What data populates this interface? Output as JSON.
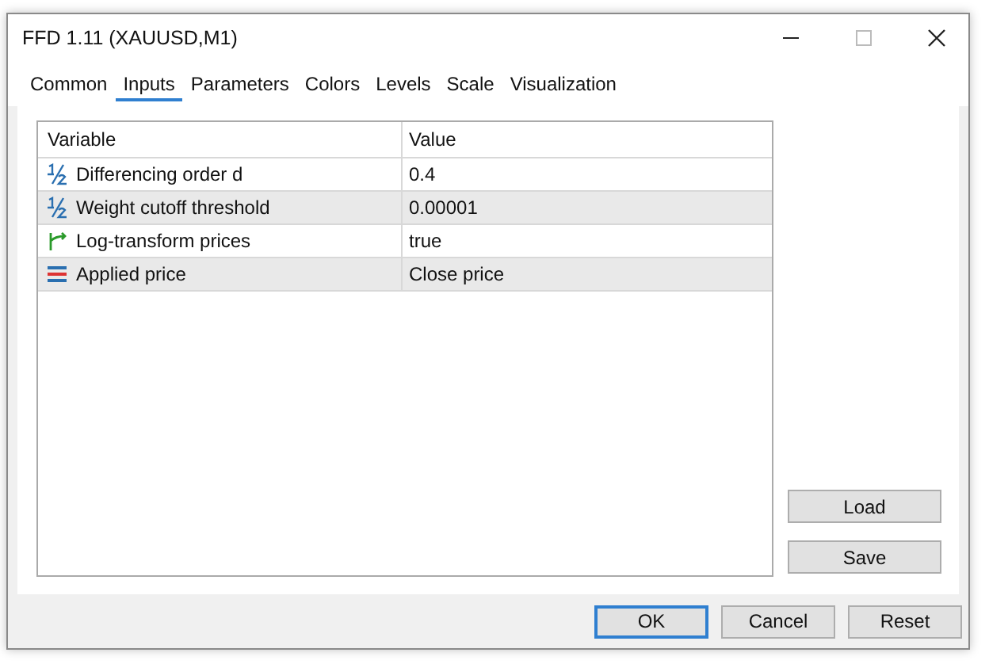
{
  "window": {
    "title": "FFD 1.11 (XAUUSD,M1)"
  },
  "tabs": [
    {
      "label": "Common",
      "selected": false
    },
    {
      "label": "Inputs",
      "selected": true
    },
    {
      "label": "Parameters",
      "selected": false
    },
    {
      "label": "Colors",
      "selected": false
    },
    {
      "label": "Levels",
      "selected": false
    },
    {
      "label": "Scale",
      "selected": false
    },
    {
      "label": "Visualization",
      "selected": false
    }
  ],
  "table": {
    "columns": [
      "Variable",
      "Value"
    ],
    "rows": [
      {
        "kind": "number",
        "variable": "Differencing order d",
        "value": "0.4"
      },
      {
        "kind": "number",
        "variable": "Weight cutoff threshold",
        "value": "0.00001"
      },
      {
        "kind": "bool",
        "variable": "Log-transform prices",
        "value": "true"
      },
      {
        "kind": "enum",
        "variable": "Applied price",
        "value": "Close price"
      }
    ]
  },
  "side_buttons": [
    "Load",
    "Save"
  ],
  "buttons": [
    {
      "label": "OK",
      "default": true
    },
    {
      "label": "Cancel",
      "default": false
    },
    {
      "label": "Reset",
      "default": false
    }
  ]
}
